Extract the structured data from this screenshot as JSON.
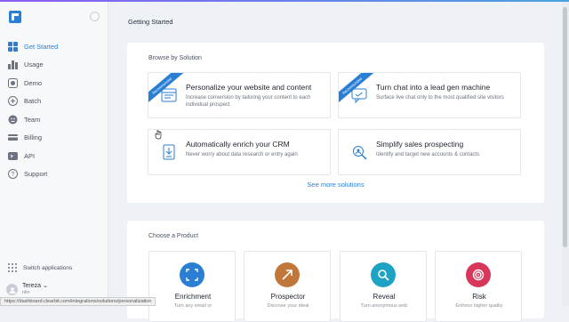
{
  "sidebar": {
    "nav": [
      {
        "label": "Get Started",
        "icon": "grid-icon",
        "active": true
      },
      {
        "label": "Usage",
        "icon": "bar-chart-icon"
      },
      {
        "label": "Demo",
        "icon": "demo-icon"
      },
      {
        "label": "Batch",
        "icon": "batch-icon"
      },
      {
        "label": "Team",
        "icon": "team-icon"
      },
      {
        "label": "Billing",
        "icon": "card-icon"
      },
      {
        "label": "API",
        "icon": "api-icon"
      },
      {
        "label": "Support",
        "icon": "help-icon"
      }
    ],
    "switch_label": "Switch applications",
    "user_name": "Tereza",
    "user_sub": "nlin"
  },
  "main": {
    "page_title": "Getting Started",
    "browse_heading": "Browse by Solution",
    "recommended_label": "Recommended",
    "solutions": [
      {
        "title": "Personalize your website and content",
        "desc": "Increase conversion by tailoring your content to each individual prospect",
        "recommended": true,
        "icon": "layout-icon"
      },
      {
        "title": "Turn chat into a lead gen machine",
        "desc": "Surface live chat only to the most qualified site visitors",
        "recommended": true,
        "icon": "chat-icon"
      },
      {
        "title": "Automatically enrich your CRM",
        "desc": "Never worry about data research or entry again",
        "recommended": false,
        "icon": "download-icon"
      },
      {
        "title": "Simplify sales prospecting",
        "desc": "Identify and target new accounts & contacts",
        "recommended": false,
        "icon": "search-people-icon"
      }
    ],
    "see_more": "See more solutions",
    "product_heading": "Choose a Product",
    "products": [
      {
        "name": "Enrichment",
        "desc": "Turn any email or",
        "color": "#2a7fd4",
        "icon": "enrichment-icon"
      },
      {
        "name": "Prospector",
        "desc": "Discover your ideal",
        "color": "#c2773a",
        "icon": "prospector-icon"
      },
      {
        "name": "Reveal",
        "desc": "Turn anonymous web",
        "color": "#1fa3c4",
        "icon": "reveal-icon"
      },
      {
        "name": "Risk",
        "desc": "Enforce higher quality",
        "color": "#d9365b",
        "icon": "risk-icon"
      }
    ]
  },
  "status_url": "https://dashboard.clearbit.com/integrations/solutions/personalization"
}
